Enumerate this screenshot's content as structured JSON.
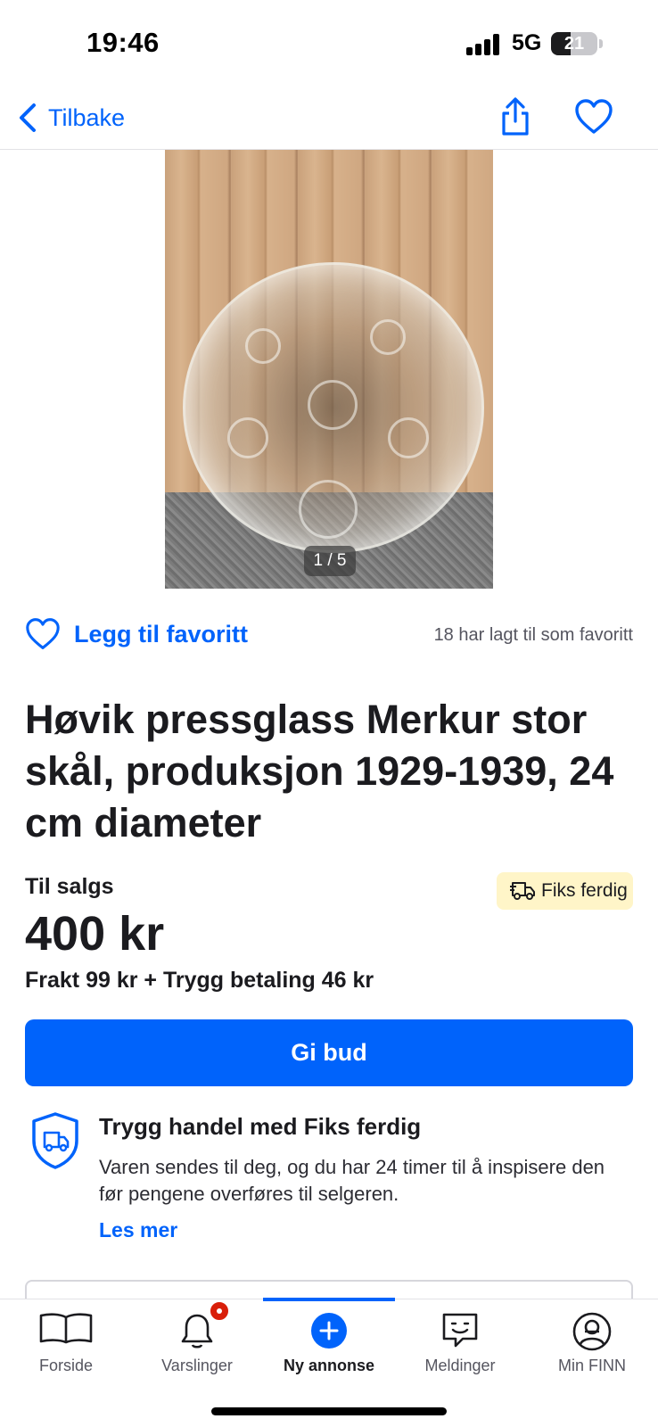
{
  "status_bar": {
    "time": "19:46",
    "network": "5G",
    "battery": "21"
  },
  "nav": {
    "back_label": "Tilbake"
  },
  "image": {
    "counter": "1 / 5"
  },
  "favorite": {
    "label": "Legg til favoritt",
    "count_text": "18 har lagt til som favoritt"
  },
  "listing": {
    "title": "Høvik pressglass Merkur stor skål, produksjon 1929-1939, 24 cm diameter",
    "sale_label": "Til salgs",
    "badge": "Fiks ferdig",
    "price": "400 kr",
    "shipping": "Frakt 99 kr + Trygg betaling 46 kr",
    "bid_button": "Gi bud"
  },
  "safe_trade": {
    "title": "Trygg handel med Fiks ferdig",
    "text": "Varen sendes til deg, og du har 24 timer til å inspisere den før pengene overføres til selgeren.",
    "link": "Les mer"
  },
  "tabbar": {
    "items": [
      {
        "label": "Forside",
        "icon": "book-icon"
      },
      {
        "label": "Varslinger",
        "icon": "bell-icon"
      },
      {
        "label": "Ny annonse",
        "icon": "plus-circle-icon"
      },
      {
        "label": "Meldinger",
        "icon": "chat-icon"
      },
      {
        "label": "Min FINN",
        "icon": "user-circle-icon"
      }
    ],
    "active_index": 2
  },
  "colors": {
    "accent": "#0063fb",
    "badge_bg": "#fff5c8",
    "notification": "#d91f0a"
  }
}
